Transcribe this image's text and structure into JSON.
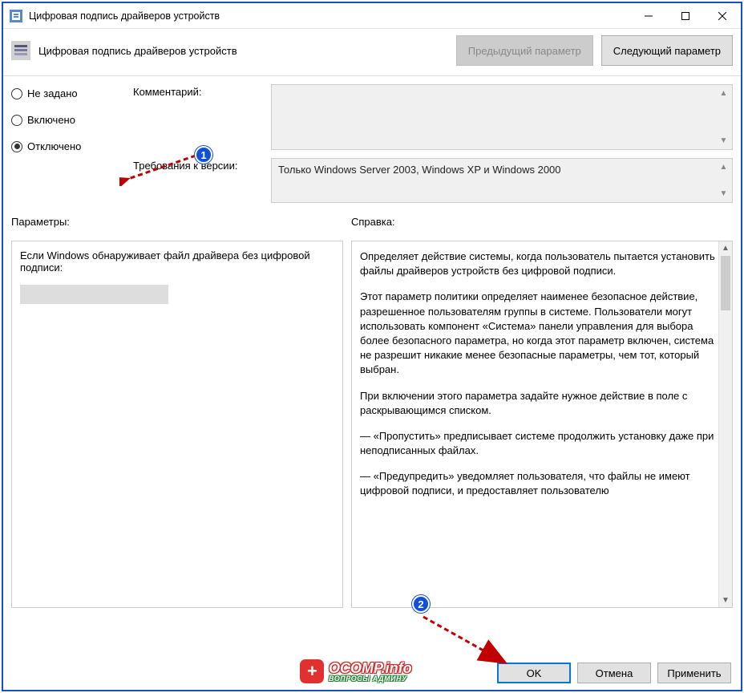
{
  "window": {
    "title": "Цифровая подпись драйверов устройств"
  },
  "header": {
    "title": "Цифровая подпись драйверов устройств",
    "prev_btn": "Предыдущий параметр",
    "next_btn": "Следующий параметр"
  },
  "radios": {
    "not_configured": "Не задано",
    "enabled": "Включено",
    "disabled": "Отключено"
  },
  "fields": {
    "comment_label": "Комментарий:",
    "supported_label": "Требования к версии:",
    "supported_value": "Только Windows Server 2003, Windows XP и Windows 2000"
  },
  "sections": {
    "params_label": "Параметры:",
    "help_label": "Справка:"
  },
  "params": {
    "text": "Если Windows обнаруживает файл драйвера без цифровой подписи:"
  },
  "help": {
    "p1": "Определяет действие системы, когда пользователь пытается установить файлы драйверов устройств без цифровой подписи.",
    "p2": "Этот параметр политики определяет наименее безопасное действие, разрешенное пользователям группы в системе. Пользователи могут использовать компонент «Система» панели управления для выбора более безопасного параметра, но когда этот параметр включен, система не разрешит никакие менее безопасные параметры, чем тот, который выбран.",
    "p3": "При включении этого параметра задайте нужное действие в поле с раскрывающимся списком.",
    "p4": "— «Пропустить» предписывает системе продолжить установку даже при неподписанных файлах.",
    "p5": "— «Предупредить» уведомляет пользователя, что файлы не имеют цифровой подписи, и предоставляет пользователю"
  },
  "buttons": {
    "ok": "OK",
    "cancel": "Отмена",
    "apply": "Применить"
  },
  "annotations": {
    "badge1": "1",
    "badge2": "2"
  },
  "watermark": {
    "top": "OCOMP.info",
    "bottom": "ВОПРОСЫ АДМИНУ"
  }
}
